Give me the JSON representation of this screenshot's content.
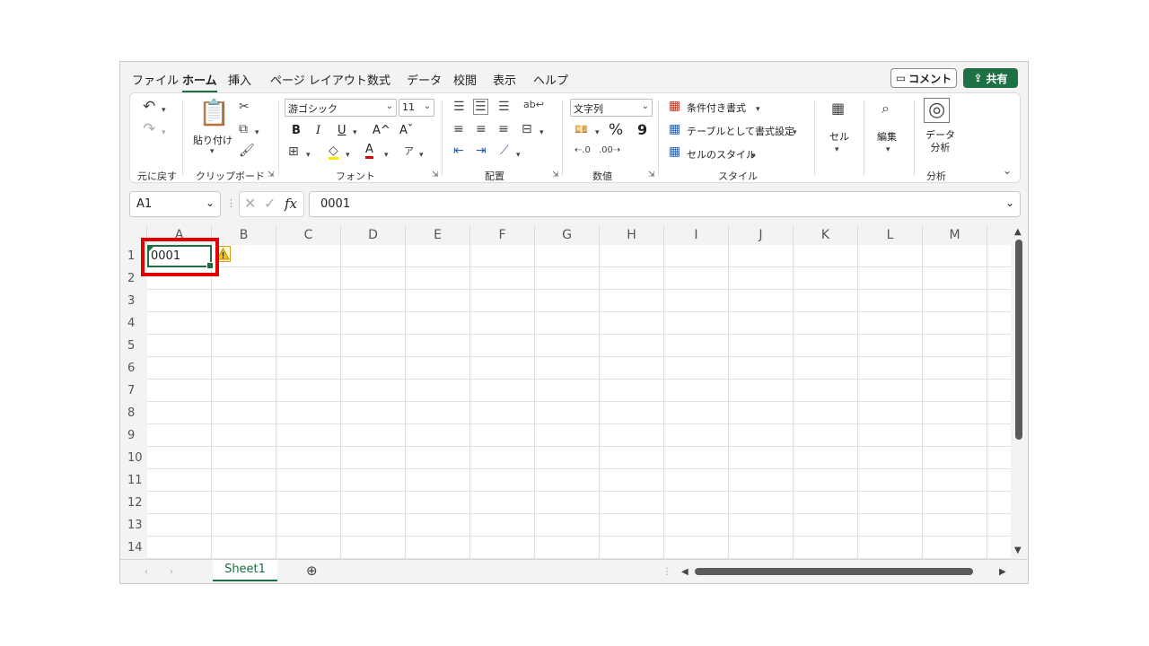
{
  "tabs": [
    "ファイル",
    "ホーム",
    "挿入",
    "ページ レイアウト",
    "数式",
    "データ",
    "校閲",
    "表示",
    "ヘルプ"
  ],
  "active_tab": "ホーム",
  "comment_label": "コメント",
  "share_label": "共有",
  "ribbon": {
    "undo_group": "元に戻す",
    "clipboard": {
      "paste": "貼り付け",
      "group": "クリップボード"
    },
    "font": {
      "name": "游ゴシック",
      "size": "11",
      "bold": "B",
      "italic": "I",
      "underline": "U",
      "grow": "A^",
      "shrink": "Aˇ",
      "color_a": "A",
      "group": "フォント"
    },
    "alignment": {
      "group": "配置"
    },
    "number": {
      "format": "文字列",
      "percent": "%",
      "comma": "9",
      "group": "数値"
    },
    "styles": {
      "conditional": "条件付き書式",
      "table": "テーブルとして書式設定",
      "cell_styles": "セルのスタイル",
      "group": "スタイル"
    },
    "cells": {
      "label": "セル"
    },
    "editing": {
      "label": "編集"
    },
    "analysis": {
      "label": "データ\n分析",
      "group": "分析"
    }
  },
  "namebox": "A1",
  "formula": "0001",
  "fx": "fx",
  "columns": [
    "A",
    "B",
    "C",
    "D",
    "E",
    "F",
    "G",
    "H",
    "I",
    "J",
    "K",
    "L",
    "M"
  ],
  "rows": [
    "1",
    "2",
    "3",
    "4",
    "5",
    "6",
    "7",
    "8",
    "9",
    "10",
    "11",
    "12",
    "13",
    "14"
  ],
  "cell_a1": "0001",
  "sheet_tab": "Sheet1",
  "colors": {
    "accent": "#1e7145",
    "highlight": "#e00000"
  }
}
